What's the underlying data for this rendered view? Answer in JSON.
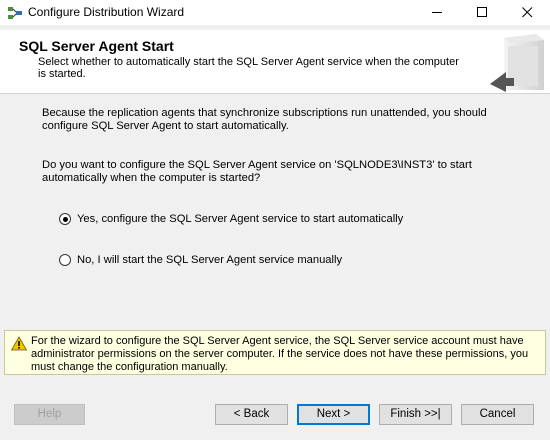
{
  "window": {
    "title": "Configure Distribution Wizard",
    "icon": "wizard-icon",
    "controls": [
      "minimize-icon",
      "maximize-icon",
      "close-icon"
    ]
  },
  "header": {
    "title": "SQL Server Agent Start",
    "subtitle": "Select whether to automatically start the SQL Server Agent service when the computer is started."
  },
  "content": {
    "paragraph1": "Because the replication agents that synchronize subscriptions run unattended, you should configure SQL Server Agent to start automatically.",
    "question": "Do you want to configure the SQL Server Agent service on 'SQLNODE3\\INST3' to start automatically when the computer is started?",
    "options": [
      {
        "label": "Yes, configure the SQL Server Agent service to start automatically",
        "selected": true
      },
      {
        "label": "No, I will start the SQL Server Agent service manually",
        "selected": false
      }
    ]
  },
  "warning": {
    "icon": "warning-icon",
    "text": "For the wizard to configure the SQL Server Agent service, the SQL Server service account must have administrator permissions on the server computer. If the service does not have these permissions, you must change the configuration manually."
  },
  "buttons": {
    "help": "Help",
    "back": "< Back",
    "next": "Next >",
    "finish": "Finish >>|",
    "cancel": "Cancel"
  },
  "colors": {
    "accent": "#0078d7",
    "warning_bg": "#ffffe1"
  }
}
